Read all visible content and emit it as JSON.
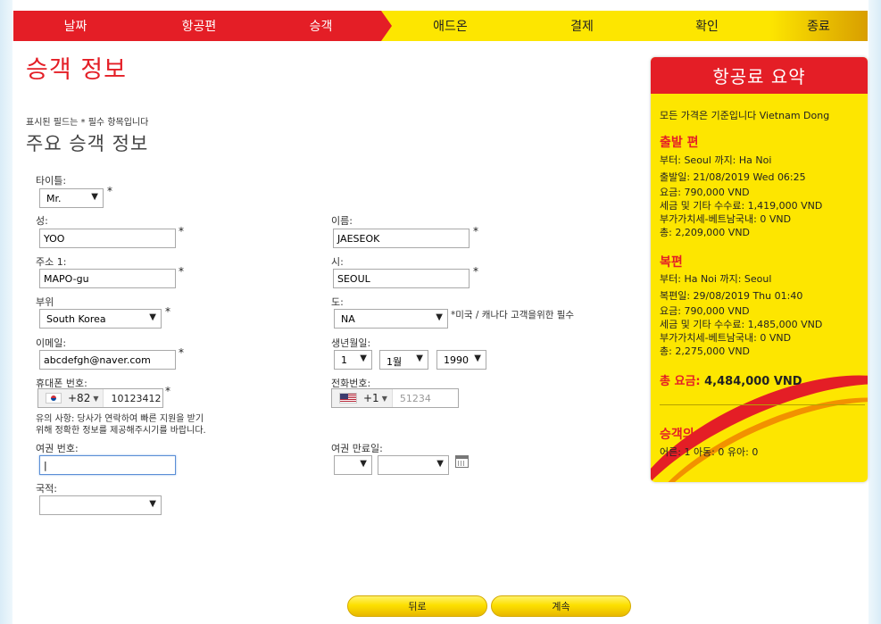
{
  "steps": [
    "날짜",
    "항공편",
    "승객",
    "애드온",
    "결제",
    "확인",
    "종료"
  ],
  "page_title": "승객 정보",
  "required_note": "표시된 필드는 * 필수 항목입니다",
  "section_title": "주요 승객 정보",
  "form": {
    "title_label": "타이틀:",
    "title_value": "Mr.",
    "last_name_label": "성:",
    "last_name_value": "YOO",
    "first_name_label": "이름:",
    "first_name_value": "JAESEOK",
    "address_label": "주소 1:",
    "address_value": "MAPO-gu",
    "city_label": "시:",
    "city_value": "SEOUL",
    "country_label": "부위",
    "country_value": "South Korea",
    "state_label": "도:",
    "state_value": "NA",
    "state_note": "*미국 / 캐나다 고객을위한 필수",
    "email_label": "이메일:",
    "email_value": "abcdefgh@naver.com",
    "dob_label": "생년월일:",
    "dob_day": "1",
    "dob_month": "1월",
    "dob_year": "1990",
    "mobile_label": "휴대폰 번호:",
    "mobile_code": "+82",
    "mobile_value": "10123412",
    "phone_label": "전화번호:",
    "phone_code": "+1",
    "phone_placeholder": "51234",
    "mobile_hint_1": "유의 사항: 당사가 연락하여 빠른 지원을 받기",
    "mobile_hint_2": "위해 정확한 정보를 제공해주시기를 바랍니다.",
    "passport_label": "여권 번호:",
    "passport_value": "|",
    "passport_exp_label": "여권 만료일:",
    "nationality_label": "국적:",
    "required_mark": "*"
  },
  "buttons": {
    "back": "뒤로",
    "continue": "계속"
  },
  "summary": {
    "title": "항공료 요약",
    "currency_note": "모든 가격은 기준입니다 Vietnam Dong",
    "outbound": {
      "heading": "출발 편",
      "route": "부터: Seoul    까지: Ha Noi",
      "date": "출발일: 21/08/2019 Wed 06:25",
      "fare": "요금: 790,000 VND",
      "tax": "세금 및 기타 수수료: 1,419,000 VND",
      "vat": "부가가치세-베트남국내: 0 VND",
      "total": "총: 2,209,000 VND"
    },
    "inbound": {
      "heading": "복편",
      "route": "부터: Ha Noi    까지: Seoul",
      "date": "복편일: 29/08/2019 Thu 01:40",
      "fare": "요금: 790,000 VND",
      "tax": "세금 및 기타 수수료: 1,485,000 VND",
      "vat": "부가가치세-베트남국내: 0 VND",
      "total": "총: 2,275,000 VND"
    },
    "grand_total_label": "총 요금:",
    "grand_total_value": "4,484,000 VND",
    "pax_heading": "승객의 수",
    "pax_counts": "어른: 1   아동: 0   유아: 0"
  },
  "colors": {
    "brand_red": "#e41e26",
    "brand_yellow": "#fde600"
  }
}
